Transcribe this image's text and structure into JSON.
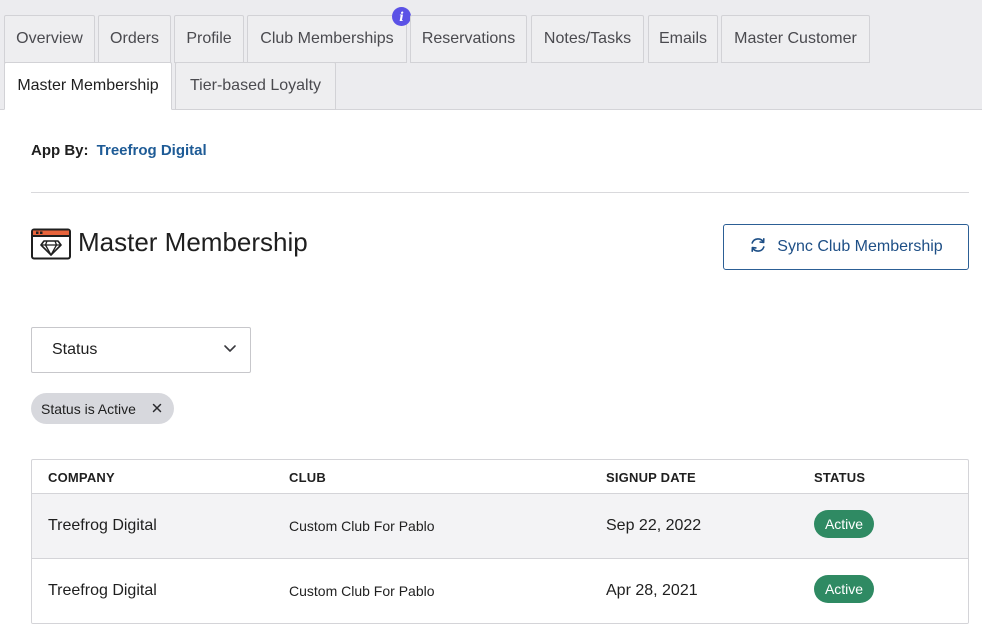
{
  "tabs": [
    {
      "label": "Overview"
    },
    {
      "label": "Orders"
    },
    {
      "label": "Profile"
    },
    {
      "label": "Club Memberships",
      "badge": "i"
    },
    {
      "label": "Reservations"
    },
    {
      "label": "Notes/Tasks"
    },
    {
      "label": "Emails"
    },
    {
      "label": "Master Customer"
    },
    {
      "label": "Master Membership",
      "active": true
    },
    {
      "label": "Tier-based Loyalty"
    }
  ],
  "app_by": {
    "label": "App By:",
    "vendor": "Treefrog Digital"
  },
  "page": {
    "title": "Master Membership",
    "title_icon": "membership-diamond-icon"
  },
  "sync_button": {
    "label": "Sync Club Membership",
    "icon": "sync-icon"
  },
  "status_select": {
    "value": "Status",
    "icon": "chevron-down-icon"
  },
  "filter_chip": {
    "label": "Status is Active",
    "icon": "close-icon"
  },
  "table": {
    "columns": [
      "COMPANY",
      "CLUB",
      "SIGNUP DATE",
      "STATUS"
    ],
    "rows": [
      {
        "company": "Treefrog Digital",
        "club": "Custom Club For Pablo",
        "signup_date": "Sep 22, 2022",
        "status": "Active"
      },
      {
        "company": "Treefrog Digital",
        "club": "Custom Club For Pablo",
        "signup_date": "Apr 28, 2021",
        "status": "Active"
      }
    ]
  },
  "colors": {
    "accent": "#1e5b96",
    "badge": "#5b52e6",
    "status_active": "#2f8a63",
    "tab_bg": "#ececef"
  }
}
